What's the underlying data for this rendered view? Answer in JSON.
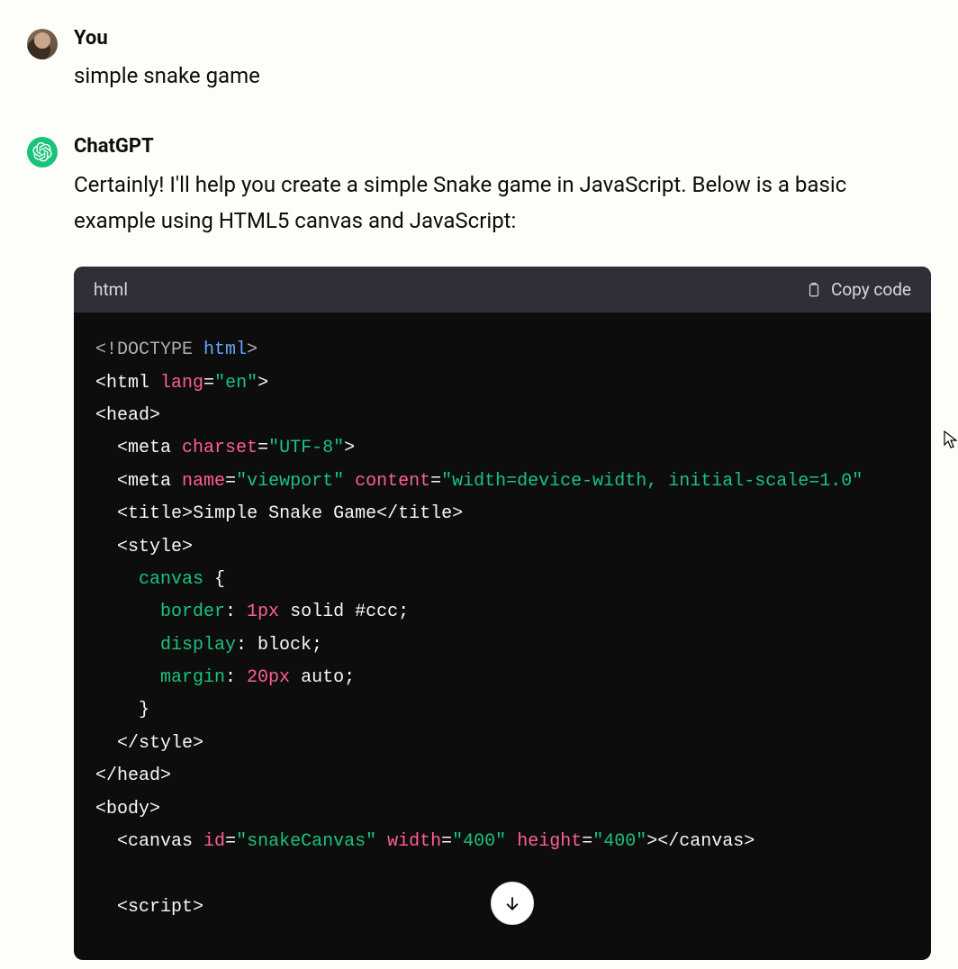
{
  "user": {
    "sender_label": "You",
    "message_text": "simple snake game"
  },
  "assistant": {
    "sender_label": "ChatGPT",
    "intro_text": "Certainly! I'll help you create a simple Snake game in JavaScript. Below is a basic example using HTML5 canvas and JavaScript:"
  },
  "code_block": {
    "language_label": "html",
    "copy_label": "Copy code",
    "tokens": [
      [
        "tok-doctype",
        "<!DOCTYPE "
      ],
      [
        "tok-keyword",
        "html"
      ],
      [
        "tok-doctype",
        ">"
      ],
      [
        "nl",
        ""
      ],
      [
        "tok-punct",
        "<"
      ],
      [
        "tok-tag",
        "html "
      ],
      [
        "tok-attr",
        "lang"
      ],
      [
        "tok-punct",
        "="
      ],
      [
        "tok-val",
        "\"en\""
      ],
      [
        "tok-punct",
        ">"
      ],
      [
        "nl",
        ""
      ],
      [
        "tok-punct",
        "<"
      ],
      [
        "tok-tag",
        "head"
      ],
      [
        "tok-punct",
        ">"
      ],
      [
        "nl",
        ""
      ],
      [
        "indent",
        "  "
      ],
      [
        "tok-punct",
        "<"
      ],
      [
        "tok-tag",
        "meta "
      ],
      [
        "tok-attr",
        "charset"
      ],
      [
        "tok-punct",
        "="
      ],
      [
        "tok-val",
        "\"UTF-8\""
      ],
      [
        "tok-punct",
        ">"
      ],
      [
        "nl",
        ""
      ],
      [
        "indent",
        "  "
      ],
      [
        "tok-punct",
        "<"
      ],
      [
        "tok-tag",
        "meta "
      ],
      [
        "tok-attr",
        "name"
      ],
      [
        "tok-punct",
        "="
      ],
      [
        "tok-val",
        "\"viewport\""
      ],
      [
        "tok-tag",
        " "
      ],
      [
        "tok-attr",
        "content"
      ],
      [
        "tok-punct",
        "="
      ],
      [
        "tok-val",
        "\"width=device-width, initial-scale=1.0\""
      ],
      [
        "nl",
        ""
      ],
      [
        "indent",
        "  "
      ],
      [
        "tok-punct",
        "<"
      ],
      [
        "tok-tag",
        "title"
      ],
      [
        "tok-punct",
        ">"
      ],
      [
        "tok-tag",
        "Simple Snake Game"
      ],
      [
        "tok-punct",
        "</"
      ],
      [
        "tok-tag",
        "title"
      ],
      [
        "tok-punct",
        ">"
      ],
      [
        "nl",
        ""
      ],
      [
        "indent",
        "  "
      ],
      [
        "tok-punct",
        "<"
      ],
      [
        "tok-tag",
        "style"
      ],
      [
        "tok-punct",
        ">"
      ],
      [
        "nl",
        ""
      ],
      [
        "indent",
        "    "
      ],
      [
        "tok-sel",
        "canvas"
      ],
      [
        "tok-punct",
        " {"
      ],
      [
        "nl",
        ""
      ],
      [
        "indent",
        "      "
      ],
      [
        "tok-prop",
        "border"
      ],
      [
        "tok-punct",
        ": "
      ],
      [
        "tok-num",
        "1px"
      ],
      [
        "tok-punct",
        " solid "
      ],
      [
        "tok-color",
        "#ccc"
      ],
      [
        "tok-punct",
        ";"
      ],
      [
        "nl",
        ""
      ],
      [
        "indent",
        "      "
      ],
      [
        "tok-prop",
        "display"
      ],
      [
        "tok-punct",
        ": block;"
      ],
      [
        "nl",
        ""
      ],
      [
        "indent",
        "      "
      ],
      [
        "tok-prop",
        "margin"
      ],
      [
        "tok-punct",
        ": "
      ],
      [
        "tok-num",
        "20px"
      ],
      [
        "tok-punct",
        " auto;"
      ],
      [
        "nl",
        ""
      ],
      [
        "indent",
        "    "
      ],
      [
        "tok-punct",
        "}"
      ],
      [
        "nl",
        ""
      ],
      [
        "indent",
        "  "
      ],
      [
        "tok-punct",
        "</"
      ],
      [
        "tok-tag",
        "style"
      ],
      [
        "tok-punct",
        ">"
      ],
      [
        "nl",
        ""
      ],
      [
        "tok-punct",
        "</"
      ],
      [
        "tok-tag",
        "head"
      ],
      [
        "tok-punct",
        ">"
      ],
      [
        "nl",
        ""
      ],
      [
        "tok-punct",
        "<"
      ],
      [
        "tok-tag",
        "body"
      ],
      [
        "tok-punct",
        ">"
      ],
      [
        "nl",
        ""
      ],
      [
        "indent",
        "  "
      ],
      [
        "tok-punct",
        "<"
      ],
      [
        "tok-tag",
        "canvas "
      ],
      [
        "tok-attr",
        "id"
      ],
      [
        "tok-punct",
        "="
      ],
      [
        "tok-val",
        "\"snakeCanvas\""
      ],
      [
        "tok-tag",
        " "
      ],
      [
        "tok-attr",
        "width"
      ],
      [
        "tok-punct",
        "="
      ],
      [
        "tok-val",
        "\"400\""
      ],
      [
        "tok-tag",
        " "
      ],
      [
        "tok-attr",
        "height"
      ],
      [
        "tok-punct",
        "="
      ],
      [
        "tok-val",
        "\"400\""
      ],
      [
        "tok-punct",
        "></"
      ],
      [
        "tok-tag",
        "canvas"
      ],
      [
        "tok-punct",
        ">"
      ],
      [
        "nl",
        ""
      ],
      [
        "nl",
        ""
      ],
      [
        "indent",
        "  "
      ],
      [
        "tok-punct",
        "<"
      ],
      [
        "tok-tag",
        "script"
      ],
      [
        "tok-punct",
        ">"
      ]
    ]
  },
  "code_raw_html": "<!DOCTYPE html>\n<html lang=\"en\">\n<head>\n  <meta charset=\"UTF-8\">\n  <meta name=\"viewport\" content=\"width=device-width, initial-scale=1.0\"\n  <title>Simple Snake Game</title>\n  <style>\n    canvas {\n      border: 1px solid #ccc;\n      display: block;\n      margin: 20px auto;\n    }\n  </style>\n</head>\n<body>\n  <canvas id=\"snakeCanvas\" width=\"400\" height=\"400\"></canvas>\n\n  <script>",
  "icons": {
    "copy": "clipboard-icon",
    "scroll_down": "arrow-down-icon",
    "assistant": "openai-logo-icon"
  }
}
